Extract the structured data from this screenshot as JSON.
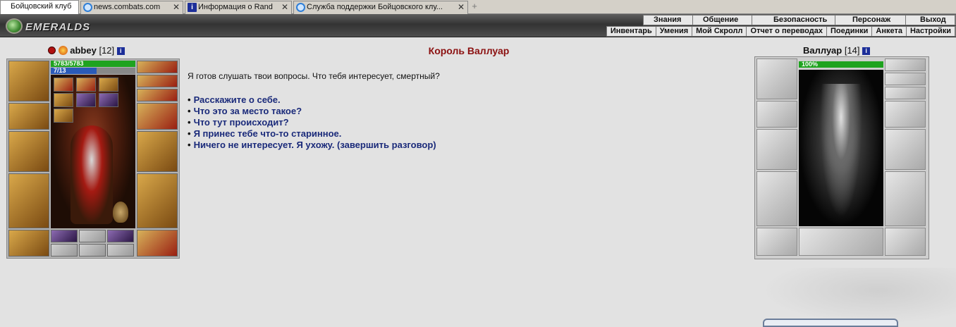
{
  "tabs": [
    {
      "label": "Бойцовский клуб",
      "active": true
    },
    {
      "label": "news.combats.com",
      "icon": "ie-icon"
    },
    {
      "label": "Информация о Rand",
      "icon": "info-icon"
    },
    {
      "label": "Служба поддержки Бойцовского клу...",
      "icon": "ie-icon"
    }
  ],
  "header": {
    "logo_text": "EMERALDS",
    "top_menu": [
      "Знания",
      "Общение",
      "Безопасность",
      "Персонаж",
      "Выход"
    ],
    "sub_menu": [
      "Инвентарь",
      "Умения",
      "Мой Скролл",
      "Отчет о переводах",
      "Поединки",
      "Анкета",
      "Настройки"
    ]
  },
  "player": {
    "name": "abbey",
    "level": "[12]",
    "hp": "5783/5783",
    "hp_fraction": 1.0,
    "mana": "7/13",
    "mana_fraction": 0.54
  },
  "npc": {
    "title": "Король Валлуар",
    "name": "Валлуар",
    "level": "[14]",
    "hp": "100%",
    "hp_fraction": 1.0
  },
  "dialog": {
    "intro": "Я готов слушать твои вопросы. Что тебя интересует, смертный?",
    "options": [
      "Расскажите о себе.",
      "Что это за место такое?",
      "Что тут происходит?",
      "Я принес тебе что-то старинное.",
      "Ничего не интересует. Я ухожу. (завершить разговор)"
    ],
    "bullet": "•"
  },
  "colors": {
    "title": "#8b1010",
    "link": "#1a2a7a",
    "hp_bar": "#1fa31f",
    "mana_bar": "#2a5ab8"
  }
}
